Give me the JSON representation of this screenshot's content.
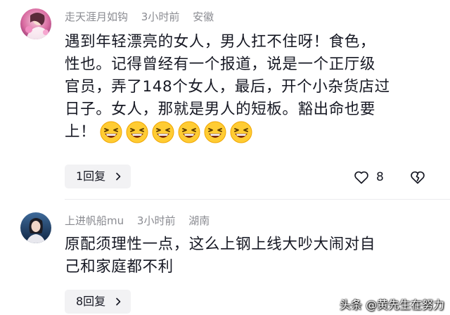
{
  "comments": [
    {
      "username": "走天涯月如钩",
      "time": "3小时前",
      "location": "安徽",
      "avatar": "avatar-pink-portrait",
      "text_lines": [
        "遇到年轻漂亮的女人，男人扛不住呀！食色，",
        "性也。记得曾经有一个报道，说是一个正厅级",
        "官员，弄了148个女人，最后，开个小杂货店过",
        "日子。女人，那就是男人的短板。豁出命也要",
        "上！"
      ],
      "emoji": "laughing-face-icon",
      "emoji_count": 6,
      "reply_label": "1回复",
      "like_count": "8"
    },
    {
      "username": "上进帆船mu",
      "time": "3小时前",
      "location": "湖南",
      "avatar": "avatar-blue-portrait",
      "text_lines": [
        "原配须理性一点，这么上钢上线大吵大闹对自",
        "己和家庭都不利"
      ],
      "reply_label": "8回复"
    }
  ],
  "watermark": "头条 @黄先生在努力",
  "colors": {
    "meta_text": "#8a8b91",
    "body_text": "#161823",
    "reply_bg": "#f2f2f4"
  }
}
